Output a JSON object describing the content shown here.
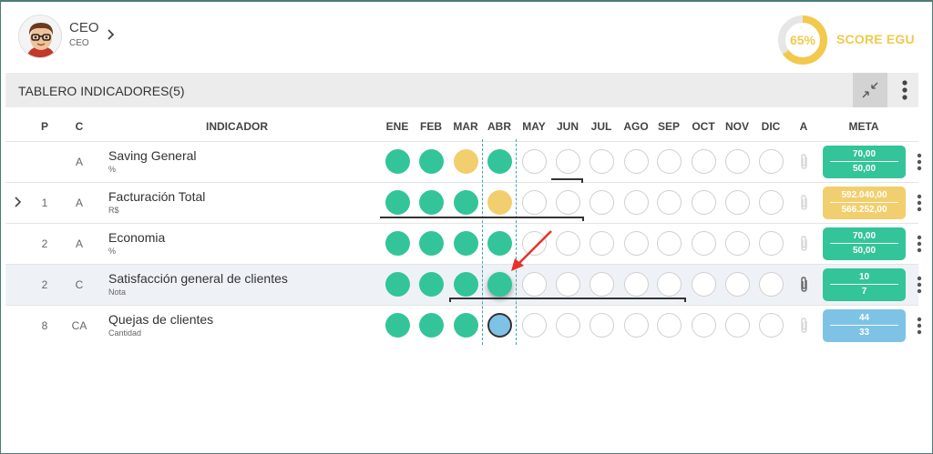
{
  "user": {
    "name": "CEO",
    "role": "CEO"
  },
  "score": {
    "percent_label": "65%",
    "percent_value": 65,
    "label": "SCORE EGU",
    "color": "#f2c94c"
  },
  "toolbar": {
    "title": "TABLERO INDICADORES(5)"
  },
  "columns": {
    "p": "P",
    "c": "C",
    "indicador": "INDICADOR",
    "months": [
      "ENE",
      "FEB",
      "MAR",
      "ABR",
      "MAY",
      "JUN",
      "JUL",
      "AGO",
      "SEP",
      "OCT",
      "NOV",
      "DIC"
    ],
    "a": "A",
    "meta": "META"
  },
  "colors": {
    "green": "#34c49a",
    "yellow": "#f2cf6e",
    "blue": "#7ec3e6",
    "highlight_row": "#eef2f7",
    "annotation_arrow": "#e8322b"
  },
  "rows": [
    {
      "p": "",
      "c": "A",
      "name": "Saving General",
      "unit": "%",
      "months": [
        "green",
        "green",
        "yellow",
        "green",
        "empty",
        "empty",
        "empty",
        "empty",
        "empty",
        "empty",
        "empty",
        "empty"
      ],
      "meta": {
        "v1": "70,00",
        "v2": "50,00",
        "color": "green"
      },
      "expandable": false,
      "has_attachment": false,
      "highlighted": false
    },
    {
      "p": "1",
      "c": "A",
      "name": "Facturación Total",
      "unit": "R$",
      "months": [
        "green",
        "green",
        "green",
        "yellow",
        "empty",
        "empty",
        "empty",
        "empty",
        "empty",
        "empty",
        "empty",
        "empty"
      ],
      "meta": {
        "v1": "592.040,00",
        "v2": "566.252,00",
        "color": "yellow"
      },
      "expandable": true,
      "has_attachment": false,
      "highlighted": false
    },
    {
      "p": "2",
      "c": "A",
      "name": "Economia",
      "unit": "%",
      "months": [
        "green",
        "green",
        "green",
        "green",
        "empty",
        "empty",
        "empty",
        "empty",
        "empty",
        "empty",
        "empty",
        "empty"
      ],
      "meta": {
        "v1": "70,00",
        "v2": "50,00",
        "color": "green"
      },
      "expandable": false,
      "has_attachment": false,
      "highlighted": false
    },
    {
      "p": "2",
      "c": "C",
      "name": "Satisfacción general de clientes",
      "unit": "Nota",
      "months": [
        "green",
        "green",
        "green",
        "green",
        "empty",
        "empty",
        "empty",
        "empty",
        "empty",
        "empty",
        "empty",
        "empty"
      ],
      "meta": {
        "v1": "10",
        "v2": "7",
        "color": "green"
      },
      "expandable": false,
      "has_attachment": true,
      "highlighted": true
    },
    {
      "p": "8",
      "c": "CA",
      "name": "Quejas de clientes",
      "unit": "Cantidad",
      "months": [
        "green",
        "green",
        "green",
        "blue",
        "empty",
        "empty",
        "empty",
        "empty",
        "empty",
        "empty",
        "empty",
        "empty"
      ],
      "meta": {
        "v1": "44",
        "v2": "33",
        "color": "blue"
      },
      "expandable": false,
      "has_attachment": false,
      "highlighted": false
    }
  ]
}
